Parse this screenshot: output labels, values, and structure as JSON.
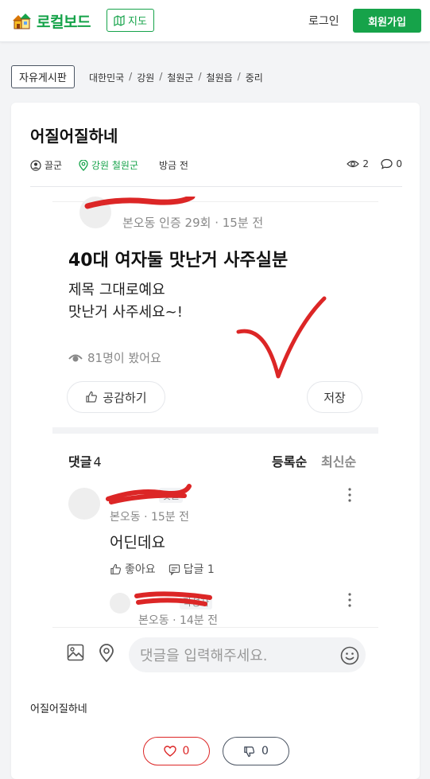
{
  "header": {
    "logo_text": "로컬보드",
    "map_label": "지도",
    "login_label": "로그인",
    "signup_label": "회원가입",
    "brand_color": "#16a34a"
  },
  "board_tag": "자유게시판",
  "breadcrumb": [
    "대한민국",
    "강원",
    "철원군",
    "철원읍",
    "중리"
  ],
  "post": {
    "title": "어질어질하네",
    "author": "끌군",
    "region": "강원 철원군",
    "time": "방금 전",
    "views": "2",
    "comments": "0",
    "body": "어질어질하네",
    "likes": "0",
    "dislikes": "0"
  },
  "screenshot": {
    "source_line": "본오동 인증 29회 · 15분 전",
    "title": "40대 여자둘 맛난거 사주실분",
    "body_line1": "제목 그대로예요",
    "body_line2": "맛난거 사주세요~!",
    "views": "81명이 봤어요",
    "empathy_label": "공감하기",
    "save_label": "저장",
    "comments_label": "댓글",
    "comments_count": "4",
    "sort_registered": "등록순",
    "sort_latest": "최신순",
    "comment1": {
      "badge": "댓글",
      "sub": "본오동 · 15분 전",
      "text": "어딘데요",
      "like_label": "좋아요",
      "reply_label": "답글 1"
    },
    "reply1": {
      "badge": "작성자",
      "sub": "본오동 · 14분 전"
    },
    "input_placeholder": "댓글을 입력해주세요."
  }
}
